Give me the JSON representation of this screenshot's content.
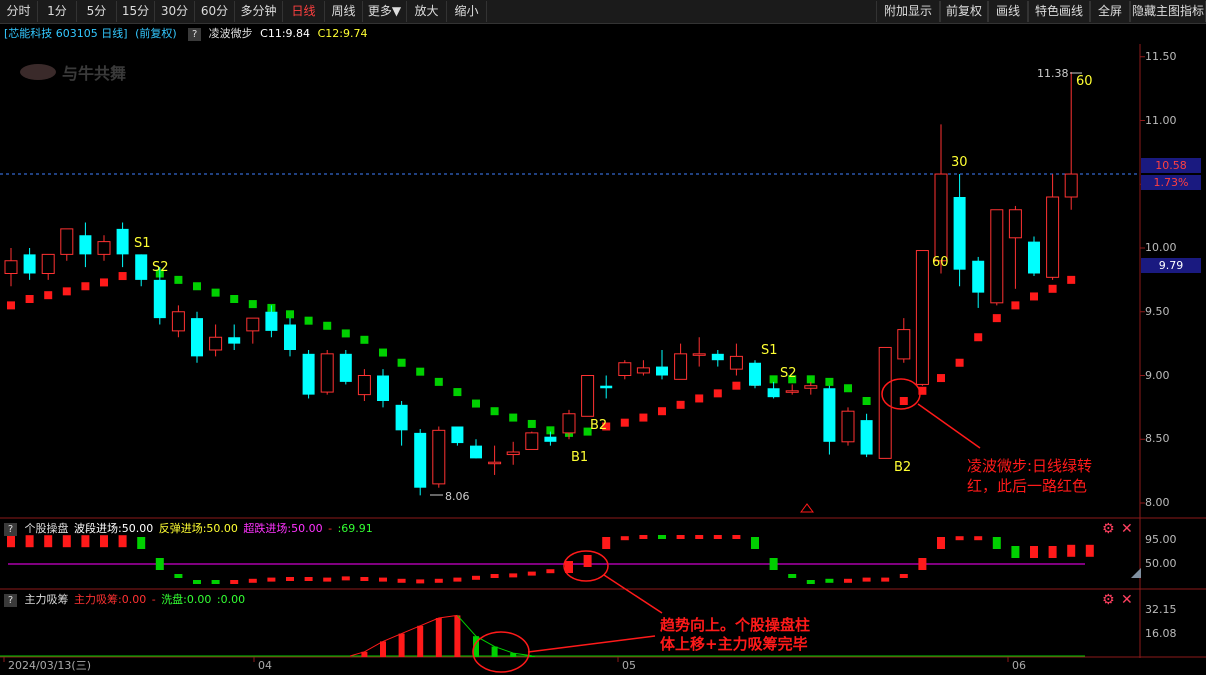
{
  "toolbar": {
    "left": [
      "分时",
      "1分",
      "5分",
      "15分",
      "30分",
      "60分",
      "多分钟",
      "日线",
      "周线",
      "更多▼",
      "放大",
      "缩小"
    ],
    "active": "日线",
    "right": [
      "附加显示",
      "前复权",
      "画线",
      "特色画线",
      "全屏",
      "隐藏主图指标"
    ]
  },
  "header": {
    "stock": "[芯能科技 603105 日线]",
    "adj": "(前复权)",
    "q": "?",
    "indicator": "凌波微步",
    "c11": "C11:9.84",
    "c12": "C12:9.74"
  },
  "watermark": "与牛共舞",
  "price_axis": {
    "labels": [
      "11.50",
      "11.00",
      "10.50",
      "10.00",
      "9.50",
      "9.00",
      "8.50",
      "8.00"
    ],
    "values": [
      11.5,
      11.0,
      10.5,
      10.0,
      9.5,
      9.0,
      8.5,
      8.0
    ],
    "current_price": "10.58",
    "current_price_value": 10.58,
    "current_pct": "1.73%",
    "c12_tag": "9.79",
    "c12_value": 9.79
  },
  "annotations_main": {
    "high_label": "11.38",
    "low_label": "8.06",
    "signals": [
      "S1",
      "S2",
      "B1",
      "B2",
      "S1",
      "S2",
      "B2",
      "60",
      "30",
      "60"
    ],
    "callout": [
      "凌波微步:日线绿转",
      "红，此后一路红色"
    ]
  },
  "panel1": {
    "q": "?",
    "name": "个股操盘",
    "t1": "波段进场:50.00",
    "t2": "反弹进场:50.00",
    "t3": "超跌进场:50.00",
    "t4": "-",
    "t5": ":69.91",
    "axis": [
      "95.00",
      "50.00"
    ]
  },
  "panel2": {
    "q": "?",
    "name": "主力吸筹",
    "t1": "主力吸筹:0.00",
    "t2": "-",
    "t3": "洗盘:0.00",
    "t4": ":0.00",
    "axis": [
      "32.15",
      "16.08"
    ],
    "callout": [
      "趋势向上。个股操盘柱",
      "体上移+主力吸筹完毕"
    ]
  },
  "dates": [
    "2024/03/13(三)",
    "04",
    "05",
    "06"
  ],
  "colors": {
    "up": "#ff3232",
    "down": "#00ffff",
    "green": "#00d000",
    "red": "#ff1a1a",
    "magenta": "#ff00ff",
    "yellow": "#ffff33",
    "axis": "#888888"
  },
  "chart_data": {
    "type": "candlestick",
    "ylim": [
      7.9,
      11.7
    ],
    "candles": [
      {
        "o": 9.8,
        "h": 10.0,
        "l": 9.7,
        "c": 9.9
      },
      {
        "o": 9.95,
        "h": 10.0,
        "l": 9.75,
        "c": 9.8
      },
      {
        "o": 9.8,
        "h": 9.95,
        "l": 9.75,
        "c": 9.95
      },
      {
        "o": 9.95,
        "h": 10.15,
        "l": 9.9,
        "c": 10.15
      },
      {
        "o": 10.1,
        "h": 10.2,
        "l": 9.85,
        "c": 9.95
      },
      {
        "o": 9.95,
        "h": 10.1,
        "l": 9.9,
        "c": 10.05
      },
      {
        "o": 10.15,
        "h": 10.2,
        "l": 9.85,
        "c": 9.95
      },
      {
        "o": 9.95,
        "h": 9.95,
        "l": 9.7,
        "c": 9.75
      },
      {
        "o": 9.75,
        "h": 9.85,
        "l": 9.4,
        "c": 9.45
      },
      {
        "o": 9.35,
        "h": 9.55,
        "l": 9.3,
        "c": 9.5
      },
      {
        "o": 9.45,
        "h": 9.5,
        "l": 9.1,
        "c": 9.15
      },
      {
        "o": 9.2,
        "h": 9.4,
        "l": 9.15,
        "c": 9.3
      },
      {
        "o": 9.3,
        "h": 9.4,
        "l": 9.2,
        "c": 9.25
      },
      {
        "o": 9.35,
        "h": 9.45,
        "l": 9.25,
        "c": 9.45
      },
      {
        "o": 9.5,
        "h": 9.55,
        "l": 9.3,
        "c": 9.35
      },
      {
        "o": 9.4,
        "h": 9.45,
        "l": 9.15,
        "c": 9.2
      },
      {
        "o": 9.17,
        "h": 9.2,
        "l": 8.82,
        "c": 8.85
      },
      {
        "o": 8.87,
        "h": 9.2,
        "l": 8.85,
        "c": 9.17
      },
      {
        "o": 9.17,
        "h": 9.2,
        "l": 8.93,
        "c": 8.95
      },
      {
        "o": 8.85,
        "h": 9.05,
        "l": 8.8,
        "c": 9.0
      },
      {
        "o": 9.0,
        "h": 9.05,
        "l": 8.75,
        "c": 8.8
      },
      {
        "o": 8.77,
        "h": 8.8,
        "l": 8.45,
        "c": 8.57
      },
      {
        "o": 8.55,
        "h": 8.58,
        "l": 8.06,
        "c": 8.12
      },
      {
        "o": 8.15,
        "h": 8.6,
        "l": 8.12,
        "c": 8.57
      },
      {
        "o": 8.6,
        "h": 8.6,
        "l": 8.45,
        "c": 8.47
      },
      {
        "o": 8.45,
        "h": 8.5,
        "l": 8.35,
        "c": 8.35
      },
      {
        "o": 8.32,
        "h": 8.45,
        "l": 8.22,
        "c": 8.32
      },
      {
        "o": 8.38,
        "h": 8.48,
        "l": 8.3,
        "c": 8.4
      },
      {
        "o": 8.42,
        "h": 8.56,
        "l": 8.42,
        "c": 8.55
      },
      {
        "o": 8.52,
        "h": 8.56,
        "l": 8.45,
        "c": 8.48
      },
      {
        "o": 8.55,
        "h": 8.73,
        "l": 8.5,
        "c": 8.7
      },
      {
        "o": 8.68,
        "h": 9.0,
        "l": 8.68,
        "c": 9.0
      },
      {
        "o": 8.92,
        "h": 9.0,
        "l": 8.82,
        "c": 8.9
      },
      {
        "o": 9.0,
        "h": 9.12,
        "l": 8.97,
        "c": 9.1
      },
      {
        "o": 9.02,
        "h": 9.12,
        "l": 9.0,
        "c": 9.06
      },
      {
        "o": 9.07,
        "h": 9.2,
        "l": 8.97,
        "c": 9.0
      },
      {
        "o": 8.97,
        "h": 9.25,
        "l": 8.97,
        "c": 9.17
      },
      {
        "o": 9.17,
        "h": 9.3,
        "l": 9.07,
        "c": 9.17
      },
      {
        "o": 9.17,
        "h": 9.2,
        "l": 9.07,
        "c": 9.12
      },
      {
        "o": 9.05,
        "h": 9.25,
        "l": 9.0,
        "c": 9.15
      },
      {
        "o": 9.1,
        "h": 9.12,
        "l": 8.9,
        "c": 8.92
      },
      {
        "o": 8.9,
        "h": 8.95,
        "l": 8.82,
        "c": 8.83
      },
      {
        "o": 8.88,
        "h": 8.93,
        "l": 8.85,
        "c": 8.88
      },
      {
        "o": 8.9,
        "h": 8.95,
        "l": 8.85,
        "c": 8.92
      },
      {
        "o": 8.9,
        "h": 8.92,
        "l": 8.38,
        "c": 8.48
      },
      {
        "o": 8.48,
        "h": 8.75,
        "l": 8.45,
        "c": 8.72
      },
      {
        "o": 8.65,
        "h": 8.7,
        "l": 8.36,
        "c": 8.38
      },
      {
        "o": 8.35,
        "h": 9.22,
        "l": 8.35,
        "c": 9.22
      },
      {
        "o": 9.13,
        "h": 9.45,
        "l": 9.1,
        "c": 9.36
      },
      {
        "o": 8.93,
        "h": 9.98,
        "l": 8.92,
        "c": 9.98
      },
      {
        "o": 9.9,
        "h": 10.97,
        "l": 9.8,
        "c": 10.58
      },
      {
        "o": 10.4,
        "h": 10.58,
        "l": 9.7,
        "c": 9.83
      },
      {
        "o": 9.9,
        "h": 9.93,
        "l": 9.53,
        "c": 9.65
      },
      {
        "o": 9.57,
        "h": 10.3,
        "l": 9.55,
        "c": 10.3
      },
      {
        "o": 10.08,
        "h": 10.33,
        "l": 9.68,
        "c": 10.3
      },
      {
        "o": 10.05,
        "h": 10.09,
        "l": 9.78,
        "c": 9.8
      },
      {
        "o": 9.77,
        "h": 10.58,
        "l": 9.75,
        "c": 10.4
      },
      {
        "o": 10.4,
        "h": 11.38,
        "l": 10.3,
        "c": 10.58
      }
    ],
    "trail": [
      {
        "i": 0,
        "v": 9.55,
        "c": "r"
      },
      {
        "i": 1,
        "v": 9.6,
        "c": "r"
      },
      {
        "i": 2,
        "v": 9.63,
        "c": "r"
      },
      {
        "i": 3,
        "v": 9.66,
        "c": "r"
      },
      {
        "i": 4,
        "v": 9.7,
        "c": "r"
      },
      {
        "i": 5,
        "v": 9.73,
        "c": "r"
      },
      {
        "i": 6,
        "v": 9.78,
        "c": "r"
      },
      {
        "i": 7,
        "v": 9.82,
        "c": "r"
      },
      {
        "i": 8,
        "v": 9.8,
        "c": "g"
      },
      {
        "i": 9,
        "v": 9.75,
        "c": "g"
      },
      {
        "i": 10,
        "v": 9.7,
        "c": "g"
      },
      {
        "i": 11,
        "v": 9.65,
        "c": "g"
      },
      {
        "i": 12,
        "v": 9.6,
        "c": "g"
      },
      {
        "i": 13,
        "v": 9.56,
        "c": "g"
      },
      {
        "i": 14,
        "v": 9.53,
        "c": "g"
      },
      {
        "i": 15,
        "v": 9.48,
        "c": "g"
      },
      {
        "i": 16,
        "v": 9.43,
        "c": "g"
      },
      {
        "i": 17,
        "v": 9.39,
        "c": "g"
      },
      {
        "i": 18,
        "v": 9.33,
        "c": "g"
      },
      {
        "i": 19,
        "v": 9.28,
        "c": "g"
      },
      {
        "i": 20,
        "v": 9.18,
        "c": "g"
      },
      {
        "i": 21,
        "v": 9.1,
        "c": "g"
      },
      {
        "i": 22,
        "v": 9.03,
        "c": "g"
      },
      {
        "i": 23,
        "v": 8.95,
        "c": "g"
      },
      {
        "i": 24,
        "v": 8.87,
        "c": "g"
      },
      {
        "i": 25,
        "v": 8.78,
        "c": "g"
      },
      {
        "i": 26,
        "v": 8.72,
        "c": "g"
      },
      {
        "i": 27,
        "v": 8.67,
        "c": "g"
      },
      {
        "i": 28,
        "v": 8.62,
        "c": "g"
      },
      {
        "i": 29,
        "v": 8.57,
        "c": "g"
      },
      {
        "i": 30,
        "v": 8.55,
        "c": "g"
      },
      {
        "i": 31,
        "v": 8.56,
        "c": "g"
      },
      {
        "i": 32,
        "v": 8.6,
        "c": "r"
      },
      {
        "i": 33,
        "v": 8.63,
        "c": "r"
      },
      {
        "i": 34,
        "v": 8.67,
        "c": "r"
      },
      {
        "i": 35,
        "v": 8.72,
        "c": "r"
      },
      {
        "i": 36,
        "v": 8.77,
        "c": "r"
      },
      {
        "i": 37,
        "v": 8.82,
        "c": "r"
      },
      {
        "i": 38,
        "v": 8.86,
        "c": "r"
      },
      {
        "i": 39,
        "v": 8.92,
        "c": "r"
      },
      {
        "i": 40,
        "v": 8.95,
        "c": "r"
      },
      {
        "i": 41,
        "v": 8.97,
        "c": "g"
      },
      {
        "i": 42,
        "v": 8.97,
        "c": "g"
      },
      {
        "i": 43,
        "v": 8.97,
        "c": "g"
      },
      {
        "i": 44,
        "v": 8.95,
        "c": "g"
      },
      {
        "i": 45,
        "v": 8.9,
        "c": "g"
      },
      {
        "i": 46,
        "v": 8.8,
        "c": "g"
      },
      {
        "i": 47,
        "v": 8.8,
        "c": "r"
      },
      {
        "i": 48,
        "v": 8.8,
        "c": "r"
      },
      {
        "i": 49,
        "v": 8.88,
        "c": "r"
      },
      {
        "i": 50,
        "v": 8.98,
        "c": "r"
      },
      {
        "i": 51,
        "v": 9.1,
        "c": "r"
      },
      {
        "i": 52,
        "v": 9.3,
        "c": "r"
      },
      {
        "i": 53,
        "v": 9.45,
        "c": "r"
      },
      {
        "i": 54,
        "v": 9.55,
        "c": "r"
      },
      {
        "i": 55,
        "v": 9.62,
        "c": "r"
      },
      {
        "i": 56,
        "v": 9.68,
        "c": "r"
      },
      {
        "i": 57,
        "v": 9.75,
        "c": "r"
      }
    ],
    "panel1": [
      {
        "i": 0,
        "v": 88,
        "c": "r"
      },
      {
        "i": 1,
        "v": 88,
        "c": "r"
      },
      {
        "i": 2,
        "v": 88,
        "c": "r"
      },
      {
        "i": 3,
        "v": 88,
        "c": "r"
      },
      {
        "i": 4,
        "v": 88,
        "c": "r"
      },
      {
        "i": 5,
        "v": 88,
        "c": "r"
      },
      {
        "i": 6,
        "v": 88,
        "c": "r"
      },
      {
        "i": 7,
        "v": 85,
        "c": "g"
      },
      {
        "i": 8,
        "v": 50,
        "c": "g"
      },
      {
        "i": 9,
        "v": 30,
        "c": "g"
      },
      {
        "i": 10,
        "v": 20,
        "c": "g"
      },
      {
        "i": 11,
        "v": 20,
        "c": "g"
      },
      {
        "i": 12,
        "v": 20,
        "c": "r"
      },
      {
        "i": 13,
        "v": 22,
        "c": "r"
      },
      {
        "i": 14,
        "v": 24,
        "c": "r"
      },
      {
        "i": 15,
        "v": 25,
        "c": "r"
      },
      {
        "i": 16,
        "v": 25,
        "c": "r"
      },
      {
        "i": 17,
        "v": 24,
        "c": "r"
      },
      {
        "i": 18,
        "v": 26,
        "c": "r"
      },
      {
        "i": 19,
        "v": 25,
        "c": "r"
      },
      {
        "i": 20,
        "v": 24,
        "c": "r"
      },
      {
        "i": 21,
        "v": 22,
        "c": "r"
      },
      {
        "i": 22,
        "v": 21,
        "c": "r"
      },
      {
        "i": 23,
        "v": 22,
        "c": "r"
      },
      {
        "i": 24,
        "v": 24,
        "c": "r"
      },
      {
        "i": 25,
        "v": 27,
        "c": "r"
      },
      {
        "i": 26,
        "v": 30,
        "c": "r"
      },
      {
        "i": 27,
        "v": 31,
        "c": "r"
      },
      {
        "i": 28,
        "v": 34,
        "c": "r"
      },
      {
        "i": 29,
        "v": 38,
        "c": "r"
      },
      {
        "i": 30,
        "v": 45,
        "c": "r"
      },
      {
        "i": 31,
        "v": 55,
        "c": "r"
      },
      {
        "i": 32,
        "v": 85,
        "c": "r"
      },
      {
        "i": 33,
        "v": 93,
        "c": "r"
      },
      {
        "i": 34,
        "v": 95,
        "c": "r"
      },
      {
        "i": 35,
        "v": 95,
        "c": "g"
      },
      {
        "i": 36,
        "v": 95,
        "c": "r"
      },
      {
        "i": 37,
        "v": 95,
        "c": "r"
      },
      {
        "i": 38,
        "v": 95,
        "c": "r"
      },
      {
        "i": 39,
        "v": 95,
        "c": "r"
      },
      {
        "i": 40,
        "v": 85,
        "c": "g"
      },
      {
        "i": 41,
        "v": 50,
        "c": "g"
      },
      {
        "i": 42,
        "v": 30,
        "c": "g"
      },
      {
        "i": 43,
        "v": 20,
        "c": "g"
      },
      {
        "i": 44,
        "v": 22,
        "c": "g"
      },
      {
        "i": 45,
        "v": 22,
        "c": "r"
      },
      {
        "i": 46,
        "v": 24,
        "c": "r"
      },
      {
        "i": 47,
        "v": 24,
        "c": "r"
      },
      {
        "i": 48,
        "v": 30,
        "c": "r"
      },
      {
        "i": 49,
        "v": 50,
        "c": "r"
      },
      {
        "i": 50,
        "v": 85,
        "c": "r"
      },
      {
        "i": 51,
        "v": 93,
        "c": "r"
      },
      {
        "i": 52,
        "v": 93,
        "c": "r"
      },
      {
        "i": 53,
        "v": 85,
        "c": "g"
      },
      {
        "i": 54,
        "v": 70,
        "c": "g"
      },
      {
        "i": 55,
        "v": 70,
        "c": "r"
      },
      {
        "i": 56,
        "v": 70,
        "c": "r"
      },
      {
        "i": 57,
        "v": 72,
        "c": "r"
      },
      {
        "i": 58,
        "v": 72,
        "c": "r"
      }
    ],
    "panel2": [
      {
        "i": 19,
        "v": 4,
        "c": "r"
      },
      {
        "i": 20,
        "v": 12,
        "c": "r"
      },
      {
        "i": 21,
        "v": 18,
        "c": "r"
      },
      {
        "i": 22,
        "v": 24,
        "c": "r"
      },
      {
        "i": 23,
        "v": 30,
        "c": "r"
      },
      {
        "i": 24,
        "v": 32,
        "c": "r"
      },
      {
        "i": 25,
        "v": 16,
        "c": "g"
      },
      {
        "i": 26,
        "v": 8,
        "c": "g"
      },
      {
        "i": 27,
        "v": 3,
        "c": "g"
      },
      {
        "i": 28,
        "v": 1,
        "c": "g"
      }
    ]
  }
}
